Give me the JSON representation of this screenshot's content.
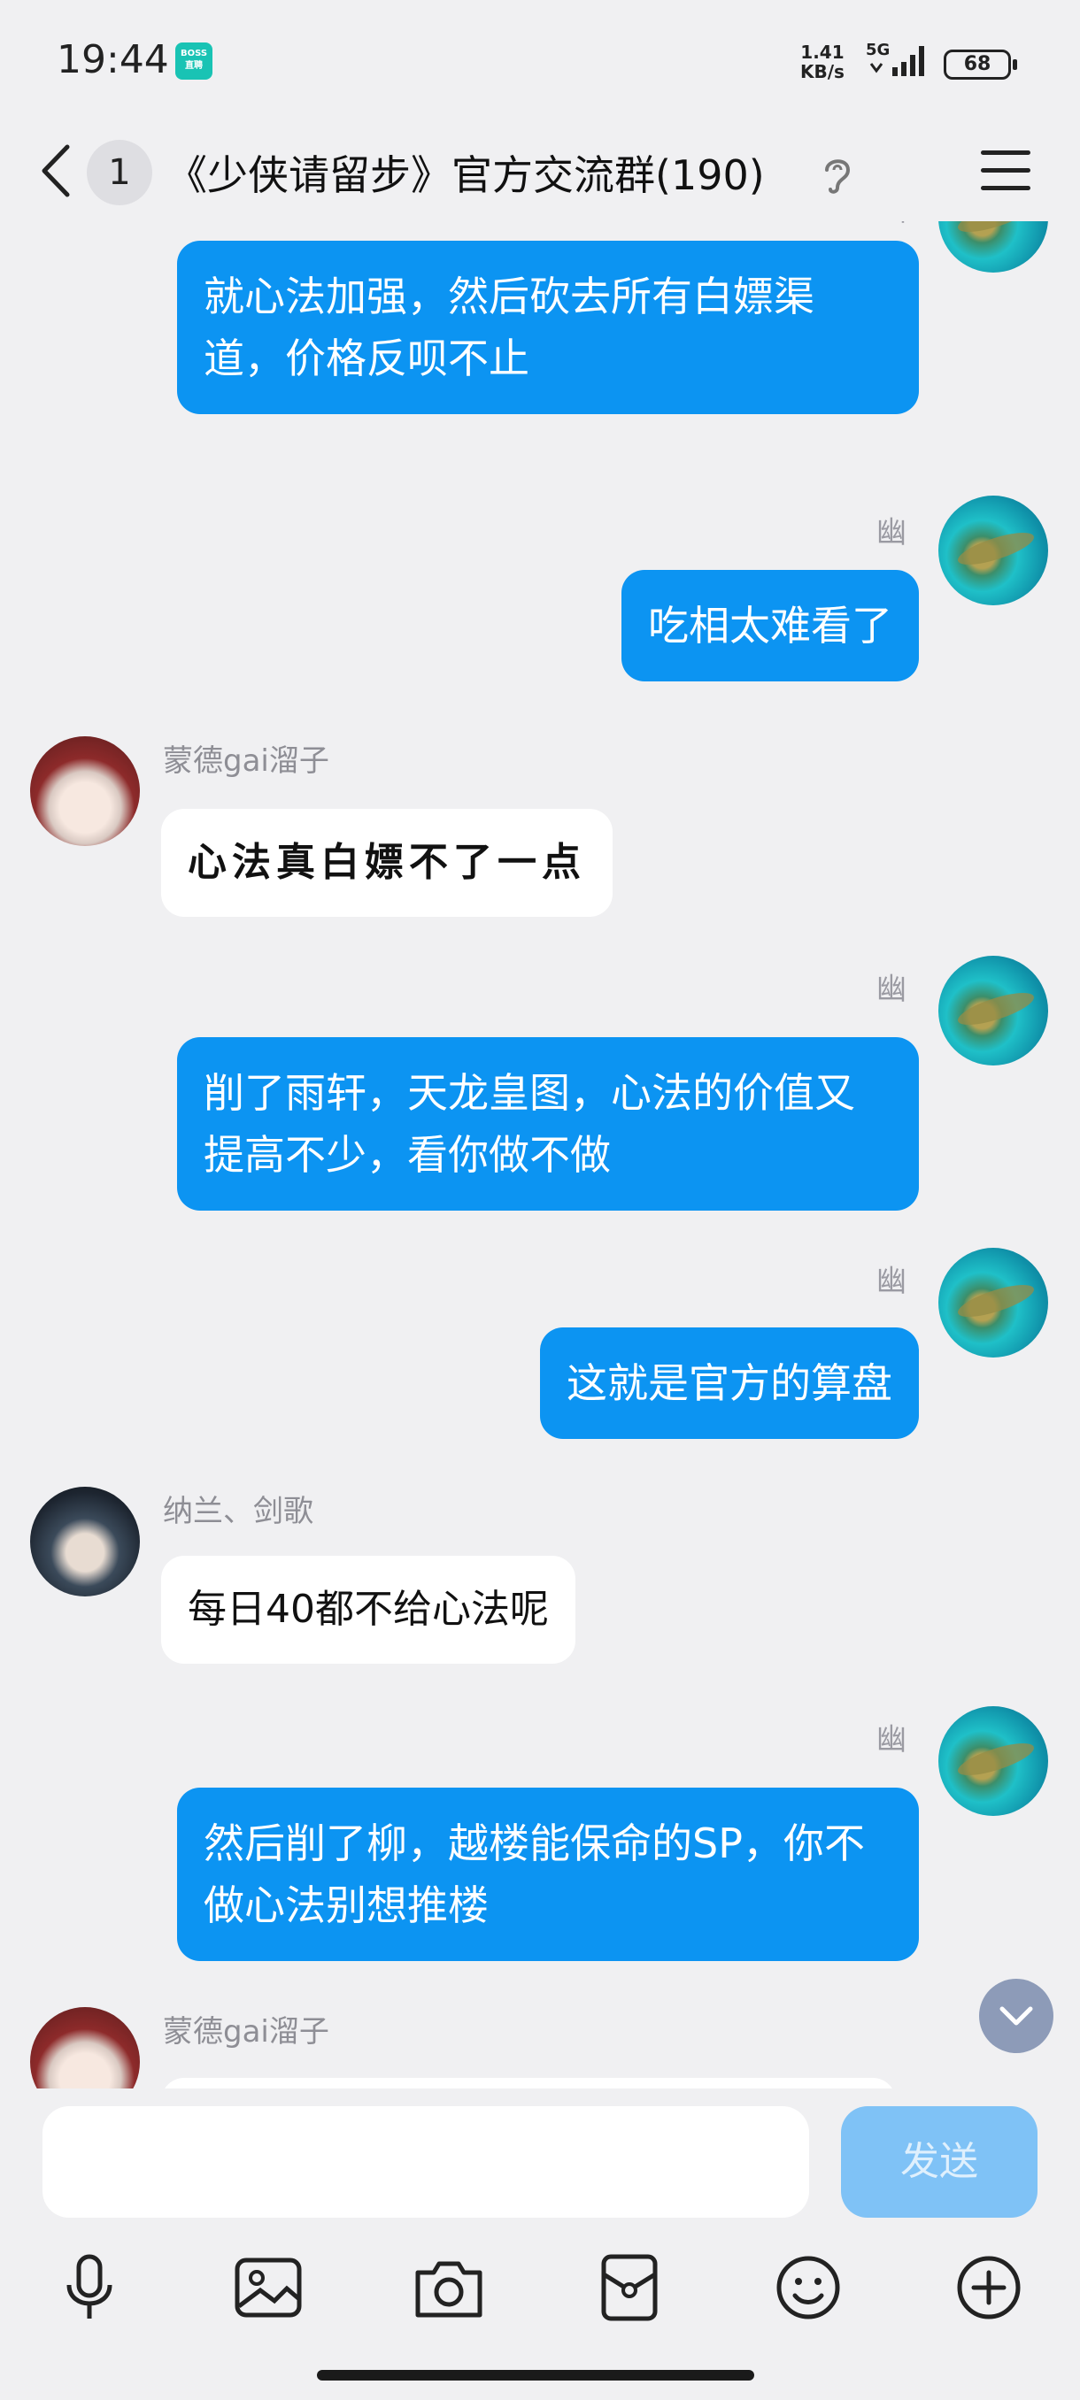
{
  "status_bar": {
    "time": "19:44",
    "app_badge": "BOSS直聘",
    "net_speed_value": "1.41",
    "net_speed_unit": "KB/s",
    "network": "5G",
    "battery": "68"
  },
  "header": {
    "unread_count": "1",
    "title": "《少侠请留步》官方交流群(190)"
  },
  "messages": [
    {
      "direction": "out",
      "sender_tag": "幽",
      "text": "就心法加强，然后砍去所有白嫖渠道，价格反呗不止"
    },
    {
      "direction": "out",
      "sender_tag": "幽",
      "text": "吃相太难看了"
    },
    {
      "direction": "in",
      "sender": "蒙德gai溜子",
      "text": "心法真白嫖不了一点"
    },
    {
      "direction": "out",
      "sender_tag": "幽",
      "text": "削了雨轩，天龙皇图，心法的价值又提高不少，看你做不做"
    },
    {
      "direction": "out",
      "sender_tag": "幽",
      "text": "这就是官方的算盘"
    },
    {
      "direction": "in",
      "sender": "纳兰、剑歌",
      "text": "每日40都不给心法呢"
    },
    {
      "direction": "out",
      "sender_tag": "幽",
      "text": "然后削了柳，越楼能保命的SP，你不做心法别想推楼"
    },
    {
      "direction": "in",
      "sender": "蒙德gai溜子",
      "text": ""
    }
  ],
  "input": {
    "value": "",
    "send_label": "发送"
  },
  "toolbar": {
    "icons": [
      "microphone-icon",
      "image-icon",
      "camera-icon",
      "red-packet-icon",
      "emoji-icon",
      "plus-icon"
    ]
  },
  "colors": {
    "outgoing_bubble": "#0c94f2",
    "incoming_bubble": "#ffffff",
    "background": "#f0f0f2",
    "send_button_disabled": "#7fc2f6"
  }
}
